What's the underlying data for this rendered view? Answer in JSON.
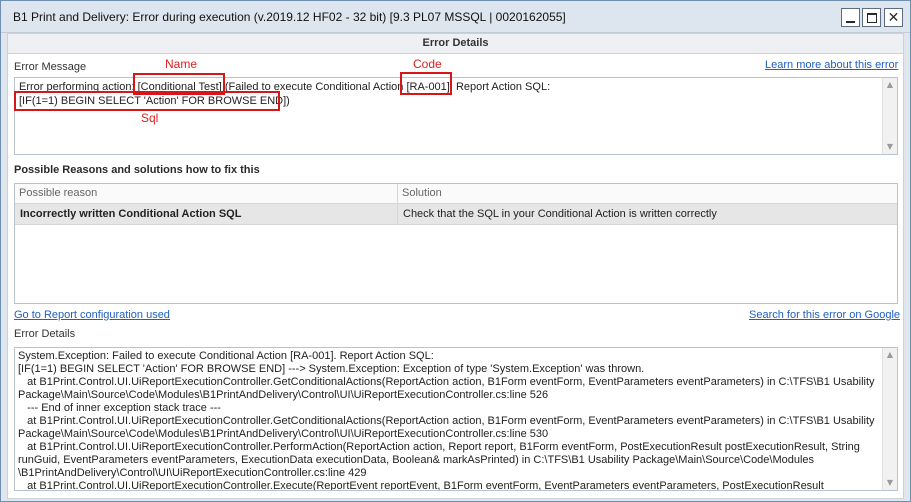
{
  "window": {
    "title": "B1 Print and Delivery: Error during execution (v.2019.12 HF02 - 32 bit) [9.3 PL07 MSSQL | 0020162055]"
  },
  "header": {
    "title": "Error Details"
  },
  "error_message": {
    "label": "Error Message",
    "learn_more_link": "Learn more about this error",
    "text": "Error performing action: [Conditional Test] (Failed to execute Conditional Action [RA-001]. Report Action SQL:\n[IF(1=1) BEGIN SELECT 'Action' FOR BROWSE END])"
  },
  "annotations": {
    "name_label": "Name",
    "code_label": "Code",
    "sql_label": "Sql",
    "color": "#d8161a"
  },
  "reasons": {
    "title": "Possible Reasons and solutions how to fix this",
    "columns": [
      "Possible reason",
      "Solution"
    ],
    "rows": [
      {
        "reason": "Incorrectly written Conditional Action SQL",
        "solution": "Check that the SQL in your Conditional Action is written correctly"
      }
    ]
  },
  "links": {
    "report_config": "Go to Report configuration used",
    "google_search": "Search for this error on Google"
  },
  "error_details": {
    "label": "Error Details",
    "text": "System.Exception: Failed to execute Conditional Action [RA-001]. Report Action SQL:\n[IF(1=1) BEGIN SELECT 'Action' FOR BROWSE END] ---> System.Exception: Exception of type 'System.Exception' was thrown.\n   at B1Print.Control.UI.UiReportExecutionController.GetConditionalActions(ReportAction action, B1Form eventForm, EventParameters eventParameters) in C:\\TFS\\B1 Usability\nPackage\\Main\\Source\\Code\\Modules\\B1PrintAndDelivery\\Control\\UI\\UiReportExecutionController.cs:line 526\n   --- End of inner exception stack trace ---\n   at B1Print.Control.UI.UiReportExecutionController.GetConditionalActions(ReportAction action, B1Form eventForm, EventParameters eventParameters) in C:\\TFS\\B1 Usability\nPackage\\Main\\Source\\Code\\Modules\\B1PrintAndDelivery\\Control\\UI\\UiReportExecutionController.cs:line 530\n   at B1Print.Control.UI.UiReportExecutionController.PerformAction(ReportAction action, Report report, B1Form eventForm, PostExecutionResult postExecutionResult, String\nrunGuid, EventParameters eventParameters, ExecutionData executionData, Boolean& markAsPrinted) in C:\\TFS\\B1 Usability Package\\Main\\Source\\Code\\Modules\n\\B1PrintAndDelivery\\Control\\UI\\UiReportExecutionController.cs:line 429\n   at B1Print.Control.UI.UiReportExecutionController.Execute(ReportEvent reportEvent, B1Form eventForm, EventParameters eventParameters, PostExecutionResult"
  },
  "icons": {
    "minimize": "minimize-icon",
    "maximize": "maximize-icon",
    "close": "close-icon",
    "scroll_up": "scroll-up-arrow-icon",
    "scroll_down": "scroll-down-arrow-icon"
  }
}
